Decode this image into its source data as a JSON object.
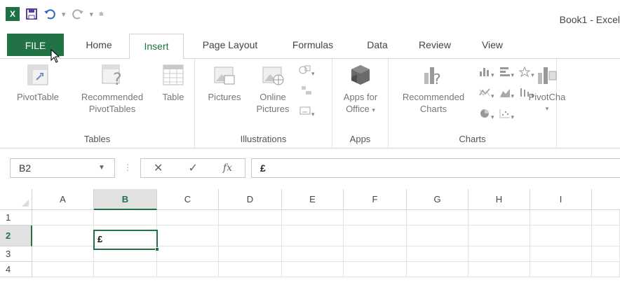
{
  "app": {
    "title": "Book1 - Excel",
    "logo_text": "X",
    "brand_color": "#217346"
  },
  "qat": {
    "icons": [
      "excel-logo-icon",
      "save-icon",
      "undo-icon",
      "redo-icon",
      "customize-qat-icon"
    ]
  },
  "tabs": [
    {
      "label": "FILE"
    },
    {
      "label": "Home"
    },
    {
      "label": "Insert"
    },
    {
      "label": "Page Layout"
    },
    {
      "label": "Formulas"
    },
    {
      "label": "Data"
    },
    {
      "label": "Review"
    },
    {
      "label": "View"
    }
  ],
  "active_tab": "Insert",
  "ribbon": {
    "groups": [
      {
        "label": "Tables",
        "buttons": [
          "PivotTable",
          "Recommended PivotTables",
          "Table"
        ]
      },
      {
        "label": "Illustrations",
        "buttons": [
          "Pictures",
          "Online Pictures"
        ]
      },
      {
        "label": "Apps",
        "buttons": [
          "Apps for Office"
        ]
      },
      {
        "label": "Charts",
        "buttons": [
          "Recommended Charts",
          "PivotChart"
        ]
      }
    ],
    "pivottable": "PivotTable",
    "recommended_pivottables_line1": "Recommended",
    "recommended_pivottables_line2": "PivotTables",
    "table": "Table",
    "pictures": "Pictures",
    "online_pictures_line1": "Online",
    "online_pictures_line2": "Pictures",
    "apps_line1": "Apps for",
    "apps_line2": "Office",
    "recommended_charts_line1": "Recommended",
    "recommended_charts_line2": "Charts",
    "pivotchart": "PivotCha"
  },
  "formula_bar": {
    "name_box": "B2",
    "cancel": "✕",
    "enter": "✓",
    "fx": "fx",
    "value": "£"
  },
  "grid": {
    "columns": [
      "A",
      "B",
      "C",
      "D",
      "E",
      "F",
      "G",
      "H",
      "I"
    ],
    "rows": [
      "1",
      "2",
      "3",
      "4"
    ],
    "selected_column": "B",
    "selected_row": "2",
    "active_cell": "B2",
    "active_cell_value": "£"
  }
}
